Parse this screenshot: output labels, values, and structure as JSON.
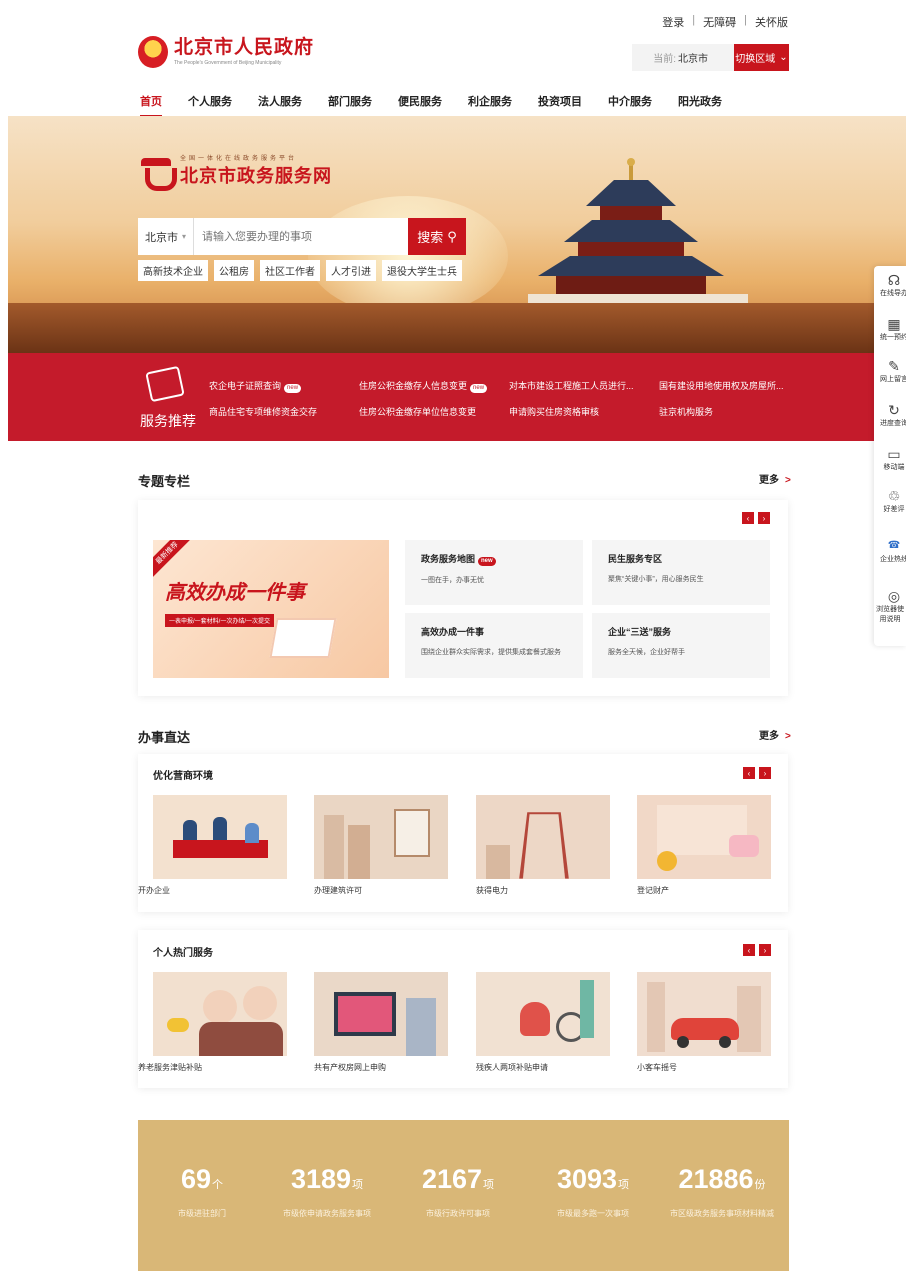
{
  "toplinks": [
    "登录",
    "无障碍",
    "关怀版"
  ],
  "header": {
    "title": "北京市人民政府",
    "subtitle": "The People's Government of Beijing Municipality",
    "region_prefix": "当前:",
    "region_value": "北京市",
    "switch_label": "切换区域"
  },
  "nav": [
    "首页",
    "个人服务",
    "法人服务",
    "部门服务",
    "便民服务",
    "利企服务",
    "投资项目",
    "中介服务",
    "阳光政务"
  ],
  "hero": {
    "platform_small": "全国一体化在线政务服务平台",
    "platform_name": "北京市政务服务网",
    "search_scope": "北京市",
    "search_placeholder": "请输入您要办理的事项",
    "search_button": "搜索",
    "tags": [
      "高新技术企业",
      "公租房",
      "社区工作者",
      "人才引进",
      "退役大学生士兵"
    ]
  },
  "recommend": {
    "label": "服务推荐",
    "new_badge": "new",
    "items": [
      {
        "text": "农企电子证照查询",
        "new": true
      },
      {
        "text": "住房公积金缴存人信息变更",
        "new": true
      },
      {
        "text": "对本市建设工程施工人员进行...",
        "new": false
      },
      {
        "text": "国有建设用地使用权及房屋所...",
        "new": false
      },
      {
        "text": "商品住宅专项维修资金交存",
        "new": false
      },
      {
        "text": "住房公积金缴存单位信息变更",
        "new": false
      },
      {
        "text": "申请购买住房资格审核",
        "new": false
      },
      {
        "text": "驻京机构服务",
        "new": false
      }
    ]
  },
  "sidebar": [
    "在线导办",
    "统一预约",
    "网上留言",
    "进度查询",
    "移动端",
    "好差评",
    "企业热线",
    "浏览器使用说明"
  ],
  "topics": {
    "title": "专题专栏",
    "more": "更多",
    "banner_corner": "最新推荐",
    "banner_title": "高效办成一件事",
    "banner_sub": "一表申报/一套材料/一次办结/一次提交",
    "tiles": [
      {
        "title": "政务服务地图",
        "desc": "一图在手，办事无忧",
        "new": true
      },
      {
        "title": "民生服务专区",
        "desc": "聚焦“关键小事”，用心服务民生",
        "new": false
      },
      {
        "title": "高效办成一件事",
        "desc": "围绕企业群众实际需求，提供集成套餐式服务",
        "new": false
      },
      {
        "title": "企业“三送”服务",
        "desc": "服务全天候，企业好帮手",
        "new": false
      }
    ]
  },
  "direct": {
    "title": "办事直达",
    "more": "更多",
    "business": {
      "title": "优化营商环境",
      "items": [
        "开办企业",
        "办理建筑许可",
        "获得电力",
        "登记财产"
      ]
    },
    "personal": {
      "title": "个人热门服务",
      "items": [
        "养老服务津贴补贴",
        "共有产权房网上申购",
        "残疾人两项补贴申请",
        "小客车摇号"
      ]
    }
  },
  "stats": [
    {
      "num": "69",
      "unit": "个",
      "label": "市级进驻部门"
    },
    {
      "num": "3189",
      "unit": "项",
      "label": "市级依申请政务服务事项"
    },
    {
      "num": "2167",
      "unit": "项",
      "label": "市级行政许可事项"
    },
    {
      "num": "3093",
      "unit": "项",
      "label": "市级最多跑一次事项"
    },
    {
      "num": "21886",
      "unit": "份",
      "label": "市区级政务服务事项材料精减"
    }
  ],
  "colors": {
    "brand_red": "#c8151d",
    "band_red": "#c41b2b",
    "stats_gold": "#d9b777"
  }
}
